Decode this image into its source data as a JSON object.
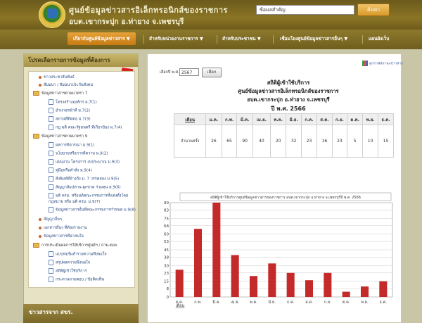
{
  "header": {
    "title": "ศูนย์ข้อมูลข่าวสารอิเล็กทรอนิกส์ของราชการ",
    "subtitle": "อบต.เขากระปุก อ.ท่ายาง จ.เพชรบุรี",
    "search_value": "ข้อมลสำคัญ",
    "search_button": "ค้นหา"
  },
  "nav": {
    "items": [
      "เกี่ยวกับศูนย์ข้อมูลข่าวสาร ▼",
      "สำหรับหน่วยงานราชการ ▼",
      "สำหรับประชาชน ▼",
      "เชื่อมโยงศูนย์ข้อมูลข่าวสารอื่นๆ ▼",
      "แผนผังเว็บ"
    ]
  },
  "sidebar": {
    "heading": "โปรดเลือกรายการข้อมูลที่ต้องการ",
    "badge": "NEW",
    "items": [
      "ข่าวประชาสัมพันธ์",
      "สัมมนา / สัมมนาประกันสังคม",
      "ข้อมูลข่าวสารตามมาตรา 7",
      "โครงสร้างองค์กร ม.7(1)",
      "อำนาจหน้าที่ ม.7(2)",
      "สถานที่ติดต่อ ม.7(3)",
      "กฎ มติ คณะรัฐมนตรี ที่เกี่ยวข้อง ม.7(4)",
      "ข้อมูลข่าวสารตามมาตรา 9",
      "ผลการพิจารณา ม.9(1)",
      "นโยบายหรือการตีความ ม.9(2)",
      "แผนงาน โครงการ งบประมาณ ม.9(3)",
      "คู่มือหรือคำสั่ง ม.9(4)",
      "สิ่งพิมพ์ที่อ้างถึง ม. 7 วรรคสอง ม.9(5)",
      "สัญญาสัมปทาน ผูกขาด ร่วมทุน ม.9(6)",
      "มติ ครม. หรือมติคณะกรรมการที่แต่งตั้งโดยกฎหมาย หรือ มติ ครม. ม.9(7)",
      "ข้อมูลข่าวสารอื่นที่คณะกรรมการกำหนด ม.9(8)",
      "สัญญาอื่นๆ",
      "เอกสารอื่นๆ ที่ต้องรายงาน",
      "ข้อมูลข่าวสารที่น่าสนใจ",
      "การประเมินผลการให้บริการศูนย์ฯ / ถาม-ตอบ",
      "แบบฟอร์มสำรวจความพึงพอใจ",
      "สรุปผลความพึงพอใจ",
      "สถิติผู้เข้าใช้บริการ",
      "กระดานถามตอบ / ข้อคิดเห็น"
    ],
    "news_heading": "ข่าวสารจาก สขร."
  },
  "main": {
    "chart_link": "ดูกราฟสถานะข่าวสาร",
    "select_label": "เลือกปี พ.ศ.",
    "select_value": "2567",
    "select_button": "เลือก",
    "title_lines": [
      "สถิติผู้เข้าใช้บริการ",
      "ศูนย์ข้อมูลข่าวสารอิเล็กทรอนิกส์ของราชการ",
      "อบต.เขากระปุก อ.ท่ายาง จ.เพชรบุรี",
      "ปี พ.ศ. 2566"
    ],
    "table_header_label": "เดือน",
    "table_row_label": "จำนวนครั้ง"
  },
  "chart_data": {
    "type": "bar",
    "title": "สถิติผู้เข้าใช้บริการศูนย์ข้อมูลข่าวสารของราชการ อบต.เขากระปุก อ.ท่ายาง จ.เพชรบุรีปี พ.ศ. 2566",
    "x_axis_label": "เดือน",
    "categories": [
      "ม.ค.",
      "ก.พ.",
      "มี.ค.",
      "เม.ย.",
      "พ.ค.",
      "มิ.ย.",
      "ก.ค.",
      "ส.ค.",
      "ก.ย.",
      "ต.ค.",
      "พ.ย.",
      "ธ.ค."
    ],
    "values": [
      26,
      65,
      90,
      40,
      20,
      32,
      23,
      16,
      23,
      5,
      10,
      15
    ],
    "ylim": [
      0,
      90
    ],
    "yticks": [
      0,
      8,
      15,
      23,
      30,
      38,
      45,
      53,
      60,
      68,
      75,
      83,
      90
    ],
    "bar_color": "#c42a2a",
    "grid": true
  },
  "colors": {
    "header_bg": "#7f6b22",
    "nav_active": "#d98c24",
    "bar": "#c42a2a"
  }
}
